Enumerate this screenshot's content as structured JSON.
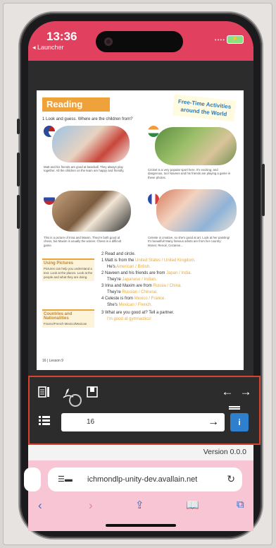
{
  "status": {
    "time": "13:36",
    "back_app": "◂ Launcher"
  },
  "book": {
    "section_title": "Reading",
    "badge": "Free-Time Activities around the World",
    "task1": "1  Look and guess. Where are the children from?",
    "captions": [
      "Matt and his friends are good at baseball. They always play together. All the children on the team are happy and friendly.",
      "Cricket is a very popular sport here. It's exciting, and dangerous, too! Naveen and his friends are playing a game in these photos.",
      "This is a picture of Irina and Maxim. They're both good at chess, but Maxim is usually the winner. Chess is a difficult game.",
      "Celeste is creative, so she's good at art. Look at her painting! It's beautiful! Many famous artists are from her country: Monet, Renoir, Cezanne..."
    ],
    "box1": {
      "title": "Using Pictures",
      "body": "Pictures can help you understand a text. Look at the places. Look at the people and what they are doing."
    },
    "box2": {
      "title": "Countries and Nationalities",
      "body": "France/French Mexico/Mexican"
    },
    "task2": "2  Read and circle.",
    "ex1a": "1  Matt is from the ",
    "ex1b": "United States / United Kingdom.",
    "ex1c": "He's ",
    "ex1d": "American / British.",
    "ex2a": "2  Naveen and his friends are from ",
    "ex2b": "Japan / India.",
    "ex2c": "They're ",
    "ex2d": "Japanese / Indian.",
    "ex3a": "3  Irina and Maxim are from ",
    "ex3b": "Russia / China.",
    "ex3c": "They're ",
    "ex3d": "Russian / Chinese.",
    "ex4a": "4  Celeste is from ",
    "ex4b": "Mexico / France.",
    "ex4c": "She's ",
    "ex4d": "Mexican / French.",
    "task3": "3  What are you good at? Tell a partner.",
    "task3_answer": "I'm good at gymnastics!",
    "page_label": "16 | Lesson 9"
  },
  "toolbar": {
    "page_value": "16",
    "info_label": "i"
  },
  "version": "Version 0.0.0",
  "browser": {
    "url": "ichmondlp-unity-dev.avallain.net"
  },
  "colors": {
    "status_bar": "#e1405f",
    "highlight": "#d8432f",
    "accent": "#2f7fcf"
  }
}
